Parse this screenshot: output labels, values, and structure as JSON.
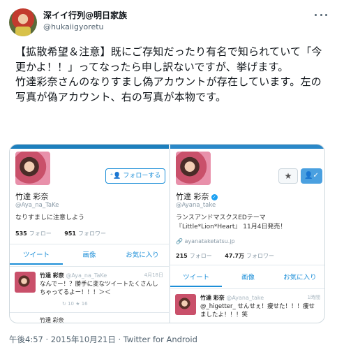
{
  "author": {
    "display_name": "深イイ行列@明日家族",
    "handle": "@hukaiigyoretu"
  },
  "tweet": {
    "text": "【拡散希望＆注意】既にご存知だったり有名で知られていて「今更かよ！！」ってなったら申し訳ないですが、挙げます。\n竹達彩奈さんのなりすまし偽アカウントが存在しています。左の写真が偽アカウント、右の写真が本物です。",
    "timestamp": "午後4:57 · 2015年10月21日 · Twitter for Android"
  },
  "fake_account": {
    "name": "竹達 彩奈",
    "handle": "@Aya_na_TaKe",
    "bio": "なりすましに注意しよう",
    "follow_button": "フォローする",
    "stats": [
      {
        "value": "535",
        "label": "フォロー"
      },
      {
        "value": "951",
        "label": "フォロワー"
      }
    ],
    "tabs": [
      "ツイート",
      "画像",
      "お気に入り"
    ],
    "tweet": {
      "name": "竹達 彩奈",
      "handle": "@Aya_na_TaKe",
      "time": "4月18日",
      "body": "なんでー！？勝手に変なツイートたくさんしちゃってるよー！！！＞＜",
      "actions": "↻ 10   ★ 16"
    },
    "next_tweet_peek": "竹達 彩奈"
  },
  "real_account": {
    "name": "竹達 彩奈",
    "handle": "@Ayana_take",
    "bio": "ランスアンドマスクスEDテーマ 『Little*Lion*Heart』 11月4日発売！",
    "url": "ayanataketatsu.jp",
    "stats": [
      {
        "value": "215",
        "label": "フォロー"
      },
      {
        "value": "47.7万",
        "label": "フォロワー"
      }
    ],
    "tabs": [
      "ツイート",
      "画像",
      "お気に入り"
    ],
    "tweet": {
      "name": "竹達 彩奈",
      "handle": "@Ayana_take",
      "time": "1時間",
      "body": "@_higetter_ せんせぇ！痩せた！！！痩せましたよ！！！笑"
    }
  },
  "icons": {
    "more": "more-icon",
    "star": "star-icon",
    "follow": "person-plus-icon",
    "verified": "verified-badge-icon"
  },
  "colors": {
    "twitter_blue": "#1d8fd8",
    "text_primary": "#0f1419",
    "text_secondary": "#536471"
  }
}
